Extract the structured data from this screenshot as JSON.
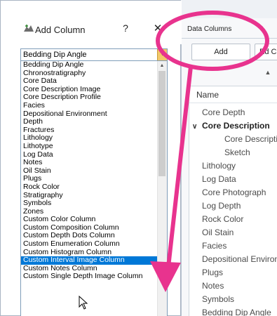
{
  "dialog": {
    "title": "Add Column",
    "help_label": "?",
    "close_label": "X",
    "combo_value": "Bedding Dip Angle",
    "items": [
      "Bedding Dip Angle",
      "Chronostratigraphy",
      "Core Data",
      "Core Description Image",
      "Core Description Profile",
      "Facies",
      "Depositional Environment",
      "Depth",
      "Fractures",
      "Lithology",
      "Lithotype",
      "Log Data",
      "Notes",
      "Oil Stain",
      "Plugs",
      "Rock Color",
      "Stratigraphy",
      "Symbols",
      "Zones",
      "Custom Color Column",
      "Custom Composition Column",
      "Custom Depth Dots Column",
      "Custom Enumeration Column",
      "Custom Histogram Column",
      "Custom Interval Image Column",
      "Custom Notes Column",
      "Custom Single Depth Image Column"
    ],
    "selected_index": 24,
    "selected_color": "#0078d7"
  },
  "data_panel": {
    "title": "Data Columns",
    "add_label": "Add",
    "second_label": "Ed C",
    "tree_header": "Name",
    "tree": [
      {
        "label": "Core Depth",
        "level": 0
      },
      {
        "label": "Core Description",
        "level": 0,
        "group": true,
        "expanded": true
      },
      {
        "label": "Core Description Image",
        "level": 1
      },
      {
        "label": "Sketch",
        "level": 1
      },
      {
        "label": "Lithology",
        "level": 0
      },
      {
        "label": "Log Data",
        "level": 0
      },
      {
        "label": "Core Photograph",
        "level": 0
      },
      {
        "label": "Log Depth",
        "level": 0
      },
      {
        "label": "Rock Color",
        "level": 0
      },
      {
        "label": "Oil Stain",
        "level": 0
      },
      {
        "label": "Facies",
        "level": 0
      },
      {
        "label": "Depositional Environment",
        "level": 0
      },
      {
        "label": "Plugs",
        "level": 0
      },
      {
        "label": "Notes",
        "level": 0
      },
      {
        "label": "Symbols",
        "level": 0
      },
      {
        "label": "Bedding Dip Angle",
        "level": 0
      }
    ]
  },
  "annotation": {
    "color": "#e8338e"
  }
}
